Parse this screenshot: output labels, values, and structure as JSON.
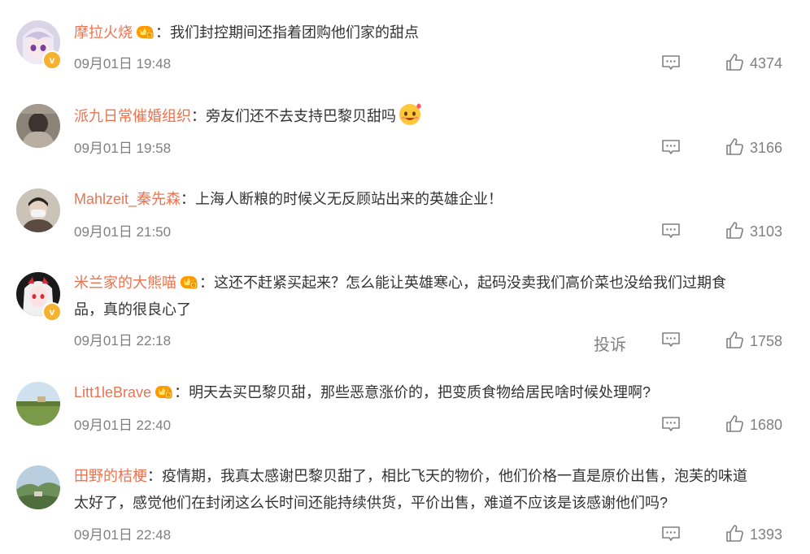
{
  "colors": {
    "username": "#eb7350",
    "meta": "#808080",
    "badge": "#f5b22e",
    "text": "#333333"
  },
  "comments": [
    {
      "user": "摩拉火烧",
      "sep": "：",
      "text": "我们封控期间还指着团购他们家的甜点",
      "time": "09月01日 19:48",
      "likes": "4374",
      "crown": true,
      "verified": true
    },
    {
      "user": "派九日常催婚组织",
      "sep": "：",
      "text": "旁友们还不去支持巴黎贝甜吗",
      "time": "09月01日 19:58",
      "likes": "3166",
      "crown": false,
      "verified": false
    },
    {
      "user": "Mahlzeit_秦先森",
      "sep": "：",
      "text": "上海人断粮的时候义无反顾站出来的英雄企业！",
      "time": "09月01日 21:50",
      "likes": "3103",
      "crown": false,
      "verified": false
    },
    {
      "user": "米兰家的大熊喵",
      "sep": "：",
      "text_line1": "这还不赶紧买起来？怎么能让英雄寒心，起码没卖我们高价菜也没给我们过期食",
      "text_line2": "品，真的很良心了",
      "time": "09月01日 22:18",
      "likes": "1758",
      "report": "投诉",
      "crown": true,
      "verified": true
    },
    {
      "user": "Litt1leBrave",
      "sep": "：",
      "text": "明天去买巴黎贝甜，那些恶意涨价的，把变质食物给居民啥时候处理啊?",
      "time": "09月01日 22:40",
      "likes": "1680",
      "crown": true,
      "verified": false
    },
    {
      "user": "田野的桔梗",
      "sep": "：",
      "text_line1": "疫情期，我真太感谢巴黎贝甜了，相比飞天的物价，他们价格一直是原价出售，泡芙的味道",
      "text_line2": "太好了，感觉他们在封闭这么长时间还能持续供货，平价出售，难道不应该是该感谢他们吗?",
      "time": "09月01日 22:48",
      "likes": "1393",
      "crown": false,
      "verified": false
    }
  ],
  "icons": {
    "reply": "comment-icon",
    "like": "thumbs-up-icon",
    "badge": "verified-v-icon",
    "crown": "vip-crown-icon"
  }
}
